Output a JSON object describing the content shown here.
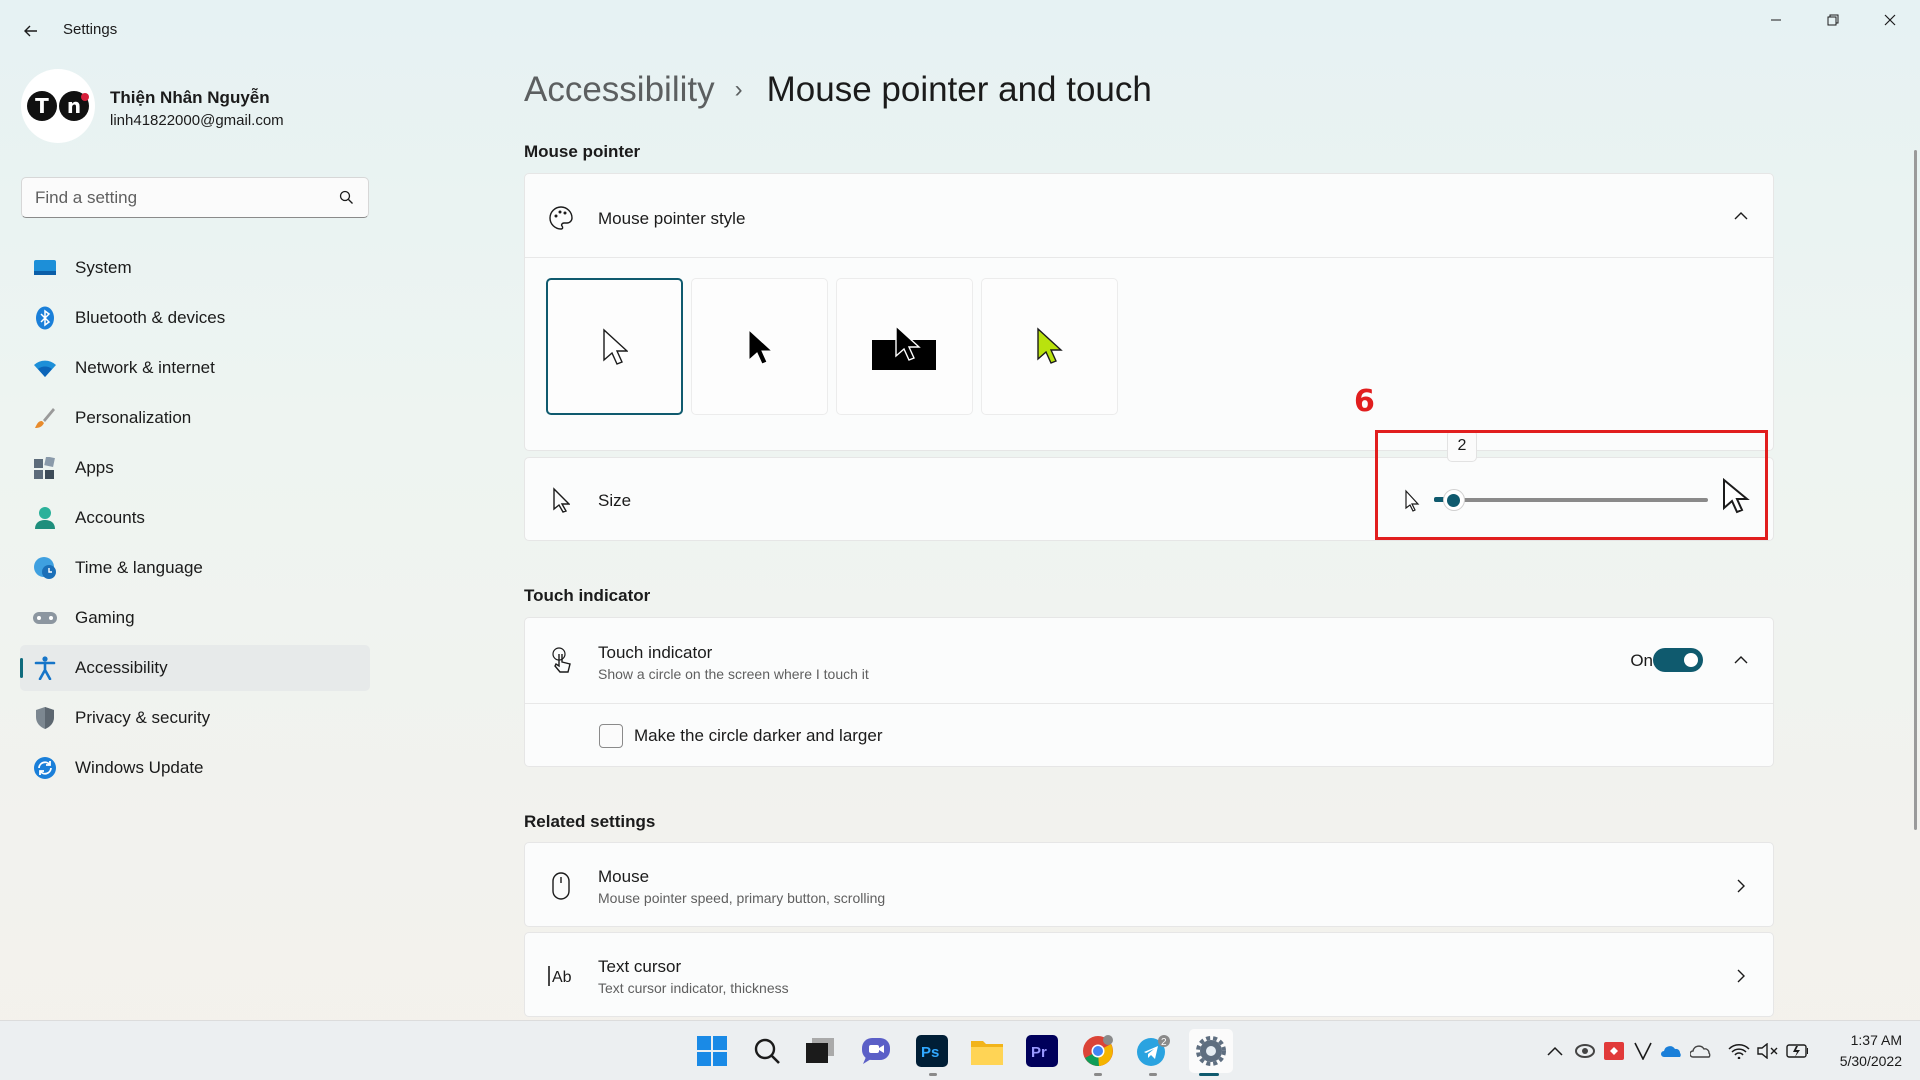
{
  "window": {
    "title": "Settings"
  },
  "profile": {
    "name": "Thiện Nhân Nguyễn",
    "email": "linh41822000@gmail.com",
    "initials_left": "T",
    "initials_right": "n"
  },
  "search": {
    "placeholder": "Find a setting"
  },
  "sidebar": {
    "items": [
      {
        "label": "System",
        "icon": "monitor-icon"
      },
      {
        "label": "Bluetooth & devices",
        "icon": "bluetooth-icon"
      },
      {
        "label": "Network & internet",
        "icon": "wifi-icon"
      },
      {
        "label": "Personalization",
        "icon": "brush-icon"
      },
      {
        "label": "Apps",
        "icon": "apps-icon"
      },
      {
        "label": "Accounts",
        "icon": "person-icon"
      },
      {
        "label": "Time & language",
        "icon": "globe-clock-icon"
      },
      {
        "label": "Gaming",
        "icon": "gamepad-icon"
      },
      {
        "label": "Accessibility",
        "icon": "accessibility-icon",
        "active": true
      },
      {
        "label": "Privacy & security",
        "icon": "shield-icon"
      },
      {
        "label": "Windows Update",
        "icon": "update-icon"
      }
    ]
  },
  "breadcrumb": {
    "parent": "Accessibility",
    "separator": "›",
    "current": "Mouse pointer and touch"
  },
  "mouse_pointer": {
    "section_title": "Mouse pointer",
    "style": {
      "title": "Mouse pointer style",
      "options": [
        "white",
        "black",
        "inverted",
        "custom"
      ],
      "selected": "white"
    },
    "size": {
      "title": "Size",
      "value": "2",
      "min": 1,
      "max": 15,
      "level": 2
    }
  },
  "annotation": {
    "number": "6"
  },
  "touch": {
    "section_title": "Touch indicator",
    "title": "Touch indicator",
    "subtitle": "Show a circle on the screen where I touch it",
    "toggle_label": "On",
    "toggle_on": true,
    "checkbox_label": "Make the circle darker and larger",
    "checkbox_checked": false
  },
  "related": {
    "section_title": "Related settings",
    "items": [
      {
        "title": "Mouse",
        "subtitle": "Mouse pointer speed, primary button, scrolling"
      },
      {
        "title": "Text cursor",
        "subtitle": "Text cursor indicator, thickness"
      }
    ]
  },
  "taskbar": {
    "apps": [
      "start-icon",
      "search-icon",
      "task-view-icon",
      "chat-icon",
      "photoshop-icon",
      "file-explorer-icon",
      "premiere-icon",
      "chrome-icon",
      "telegram-icon",
      "settings-icon"
    ],
    "photoshop_label": "Ps",
    "premiere_label": "Pr",
    "telegram_badge": "2"
  },
  "clock": {
    "time": "1:37 AM",
    "date": "5/30/2022"
  },
  "colors": {
    "accent": "#0f5a6e",
    "annotation": "#e11e1e"
  }
}
